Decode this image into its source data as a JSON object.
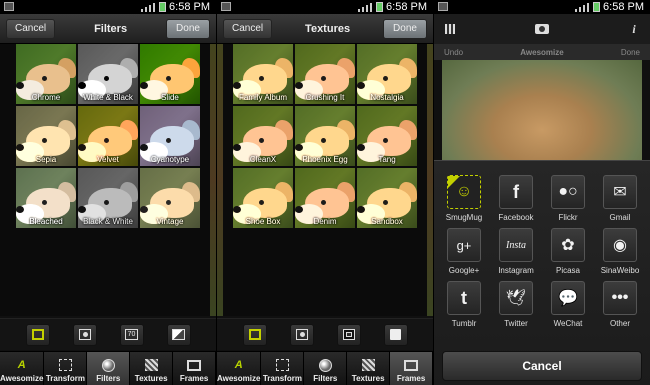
{
  "status": {
    "time": "6:58 PM"
  },
  "panel1": {
    "title": "Filters",
    "cancel": "Cancel",
    "done": "Done",
    "tiles": [
      "Chrome",
      "White & Black",
      "Slide",
      "Sepia",
      "Velvet",
      "Cyanotype",
      "Bleached",
      "Black & White",
      "Vintage"
    ],
    "sub_tools": [
      "select-icon",
      "portrait-icon",
      "70",
      "diagonal-icon"
    ]
  },
  "panel2": {
    "title": "Textures",
    "cancel": "Cancel",
    "done": "Done",
    "tiles": [
      "Family Album",
      "Crushing It",
      "Nostalgia",
      "CleanX",
      "Phoenix Egg",
      "Tang",
      "Shoe Box",
      "Denim",
      "Sandbox"
    ]
  },
  "tabs": [
    "Awesomize",
    "Transform",
    "Filters",
    "Textures",
    "Frames"
  ],
  "panel3": {
    "ghost_left": "Undo",
    "ghost_title": "Awesomize",
    "ghost_right": "Done",
    "share": [
      "SmugMug",
      "Facebook",
      "Flickr",
      "Gmail",
      "Google+",
      "Instagram",
      "Picasa",
      "SinaWeibo",
      "Tumblr",
      "Twitter",
      "WeChat",
      "Other"
    ],
    "cancel": "Cancel"
  },
  "colors": {
    "accent": "#c3d000",
    "done": "#8a9094"
  }
}
